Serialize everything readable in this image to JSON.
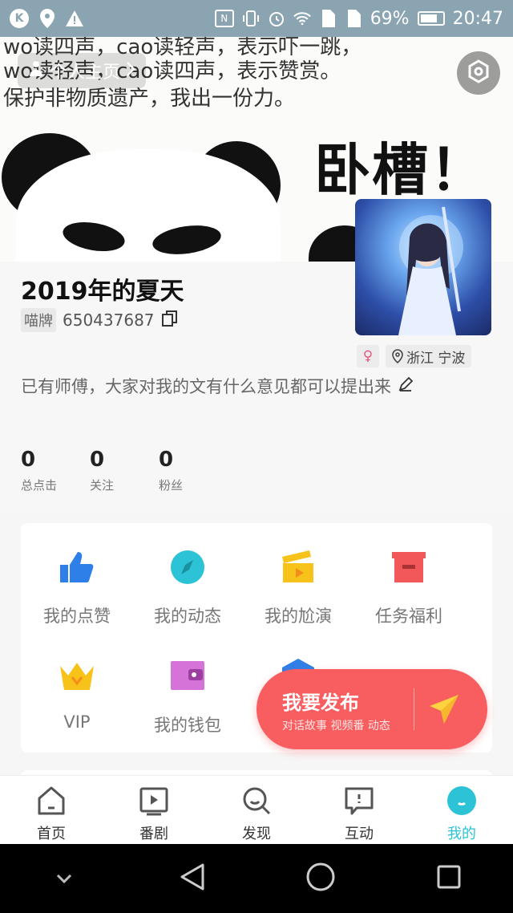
{
  "status_bar": {
    "battery_percent": "69%",
    "time": "20:47",
    "left_icons": [
      "k-app-icon",
      "location-icon",
      "warning-icon"
    ],
    "right_icons": [
      "nfc-icon",
      "vibrate-icon",
      "alarm-icon",
      "wifi-icon",
      "sim-icon",
      "sim2-icon",
      "battery-icon"
    ]
  },
  "header": {
    "homepage_button_label": "个人主页",
    "meme_lines": [
      "wo读四声，cao读轻声，表示吓一跳，",
      "wo读轻声，cao读四声，表示赞赏。",
      "保护非物质遗产，我出一份力。"
    ],
    "meme_exclaim": "卧槽！"
  },
  "profile": {
    "username": "2019年的夏天",
    "id_badge": "喵牌",
    "id_number": "650437687",
    "gender_symbol": "♀",
    "location": "浙江 宁波",
    "bio": "已有师傅，大家对我的文有什么意见都可以提出来"
  },
  "stats": [
    {
      "value": "0",
      "label": "总点击"
    },
    {
      "value": "0",
      "label": "关注"
    },
    {
      "value": "0",
      "label": "粉丝"
    }
  ],
  "menu": {
    "items": [
      {
        "label": "我的点赞",
        "icon": "thumbs-up-icon",
        "color": "#2e7fe8"
      },
      {
        "label": "我的动态",
        "icon": "compass-icon",
        "color": "#2cc3d6"
      },
      {
        "label": "我的尬演",
        "icon": "clapperboard-icon",
        "color": "#f7c21a"
      },
      {
        "label": "任务福利",
        "icon": "gift-box-icon",
        "color": "#f2575a"
      },
      {
        "label": "VIP",
        "icon": "crown-icon",
        "color": "#f7c21a"
      },
      {
        "label": "我的钱包",
        "icon": "wallet-icon",
        "color": "#d673d9"
      }
    ]
  },
  "publish": {
    "title": "我要发布",
    "subtitle": "对话故事  视频番  动态",
    "color": "#f85d5f"
  },
  "tabs": [
    {
      "label": "首页",
      "icon": "home-icon"
    },
    {
      "label": "番剧",
      "icon": "play-icon"
    },
    {
      "label": "发现",
      "icon": "discover-icon"
    },
    {
      "label": "互动",
      "icon": "chat-icon"
    },
    {
      "label": "我的",
      "icon": "profile-icon",
      "active": true
    }
  ],
  "accent_color": "#2cc3d6"
}
